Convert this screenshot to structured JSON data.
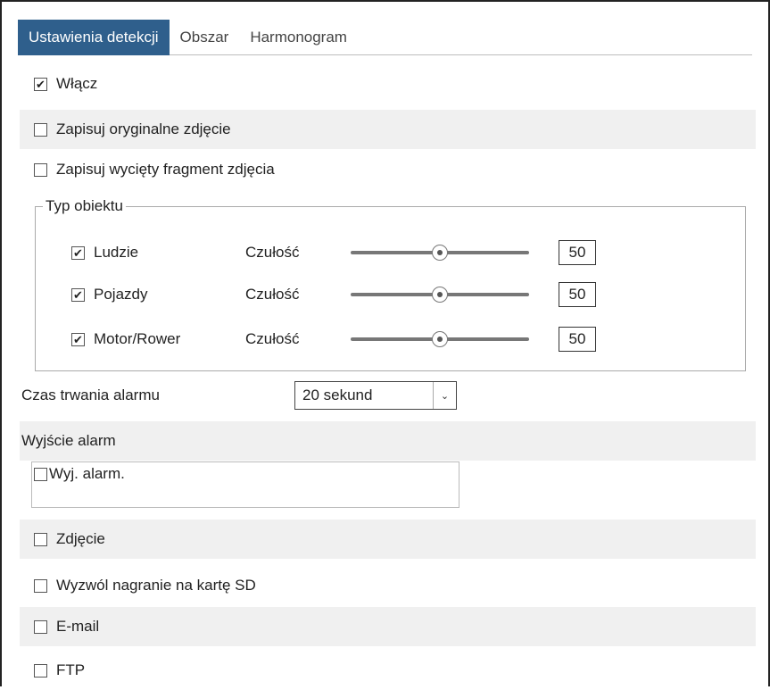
{
  "tabs": [
    {
      "label": "Ustawienia detekcji",
      "active": true
    },
    {
      "label": "Obszar",
      "active": false
    },
    {
      "label": "Harmonogram",
      "active": false
    }
  ],
  "enable": {
    "label": "Włącz",
    "checked": true
  },
  "save_original": {
    "label": "Zapisuj oryginalne zdjęcie",
    "checked": false
  },
  "save_cropped": {
    "label": "Zapisuj wycięty fragment zdjęcia",
    "checked": false
  },
  "object_type": {
    "legend": "Typ obiektu",
    "items": [
      {
        "label": "Ludzie",
        "checked": true,
        "sensitivity_label": "Czułość",
        "value": "50",
        "level": 50
      },
      {
        "label": "Pojazdy",
        "checked": true,
        "sensitivity_label": "Czułość",
        "value": "50",
        "level": 50
      },
      {
        "label": "Motor/Rower",
        "checked": true,
        "sensitivity_label": "Czułość",
        "value": "50",
        "level": 50
      }
    ]
  },
  "alarm_duration": {
    "label": "Czas trwania alarmu",
    "value": "20 sekund"
  },
  "alarm_output": {
    "label": "Wyjście alarm",
    "item": {
      "label": "Wyj. alarm.",
      "checked": false
    }
  },
  "actions": [
    {
      "label": "Zdjęcie",
      "checked": false
    },
    {
      "label": "Wyzwól nagranie na kartę SD",
      "checked": false
    },
    {
      "label": "E-mail",
      "checked": false
    },
    {
      "label": "FTP",
      "checked": false
    }
  ],
  "colors": {
    "active_tab": "#2f5f8c",
    "row_shade": "#f0f0f0"
  },
  "icons": {
    "checked": "checkbox-checked-icon",
    "unchecked": "checkbox-unchecked-icon",
    "dropdown": "chevron-down-icon"
  }
}
